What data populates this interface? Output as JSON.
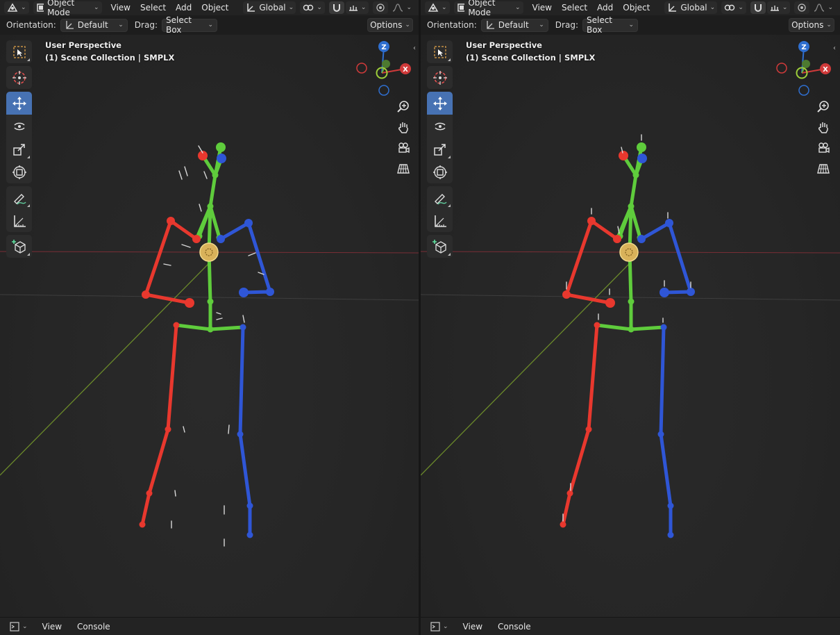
{
  "panes": [
    {
      "id": "left",
      "header": {
        "mode_label": "Object Mode",
        "menus": [
          "View",
          "Select",
          "Add",
          "Object"
        ],
        "transform_orientation": "Global"
      },
      "toolbar2": {
        "orientation_label": "Orientation:",
        "orientation_value": "Default",
        "drag_label": "Drag:",
        "drag_value": "Select Box",
        "options_label": "Options"
      },
      "viewport": {
        "perspective": "User Perspective",
        "collection": "(1) Scene Collection | SMPLX"
      },
      "footer": {
        "menus": [
          "View",
          "Console"
        ]
      }
    },
    {
      "id": "right",
      "header": {
        "mode_label": "Object Mode",
        "menus": [
          "View",
          "Select",
          "Add",
          "Object"
        ],
        "transform_orientation": "Global"
      },
      "toolbar2": {
        "orientation_label": "Orientation:",
        "orientation_value": "Default",
        "drag_label": "Drag:",
        "drag_value": "Select Box",
        "options_label": "Options"
      },
      "viewport": {
        "perspective": "User Perspective",
        "collection": "(1) Scene Collection | SMPLX"
      },
      "footer": {
        "menus": [
          "View",
          "Console"
        ]
      }
    }
  ],
  "gizmo": {
    "z": "Z",
    "x": "X"
  },
  "colors": {
    "bone_left": "#e8382e",
    "bone_right": "#2f56d6",
    "bone_center": "#5fcc3c",
    "accent": "#4772b3"
  },
  "tools": [
    "select-box-tool",
    "cursor-tool",
    "move-tool",
    "rotate-tool",
    "scale-tool",
    "transform-tool",
    "annotate-tool",
    "measure-tool",
    "add-cube-tool"
  ]
}
